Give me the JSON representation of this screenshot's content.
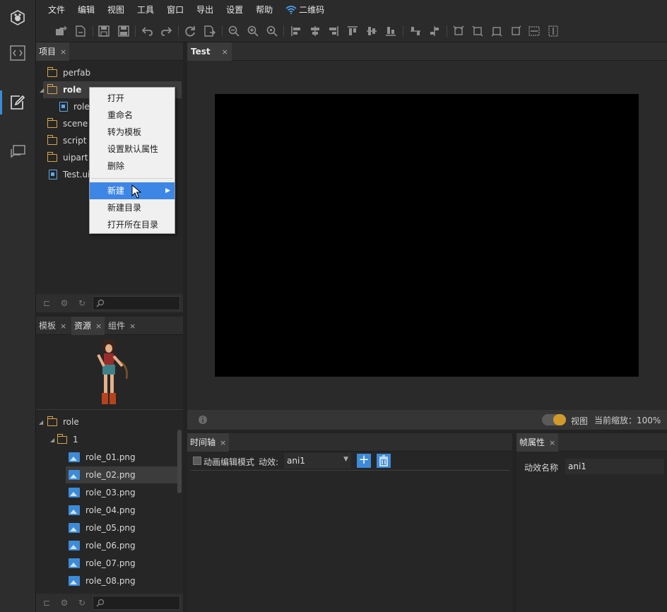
{
  "menubar": {
    "items": [
      "文件",
      "编辑",
      "视图",
      "工具",
      "窗口",
      "导出",
      "设置",
      "帮助"
    ],
    "qrcode_label": "二维码"
  },
  "project_panel": {
    "tab_label": "项目",
    "tree": {
      "perfab": "perfab",
      "role": "role",
      "role_child": "role",
      "scene": "scene",
      "script": "script",
      "uipart": "uipart",
      "test_file": "Test.ui"
    }
  },
  "context_menu": {
    "items": [
      "打开",
      "重命名",
      "转为模板",
      "设置默认属性",
      "删除"
    ],
    "new_label": "新建",
    "new_dir_label": "新建目录",
    "open_dir_label": "打开所在目录"
  },
  "assets_panel": {
    "tabs": [
      "模板",
      "资源",
      "组件"
    ],
    "active_tab": "资源",
    "root_folder": "role",
    "sub_folder": "1",
    "files": [
      "role_01.png",
      "role_02.png",
      "role_03.png",
      "role_04.png",
      "role_05.png",
      "role_06.png",
      "role_07.png",
      "role_08.png"
    ],
    "selected_file": "role_02.png"
  },
  "editor": {
    "tab_label": "Test"
  },
  "status_bar": {
    "view_label": "视图",
    "zoom_label": "当前缩放：100%"
  },
  "timeline_panel": {
    "tab_label": "时间轴",
    "mode_label": "动画编辑模式",
    "effect_label": "动效:",
    "effect_value": "ani1"
  },
  "frame_props_panel": {
    "tab_label": "帧属性",
    "name_label": "动效名称",
    "name_value": "ani1"
  },
  "colors": {
    "accent": "#3d8bd8",
    "folder": "#d8a449",
    "menu_highlight": "#3d86e6",
    "toggle": "#d19a2a"
  }
}
